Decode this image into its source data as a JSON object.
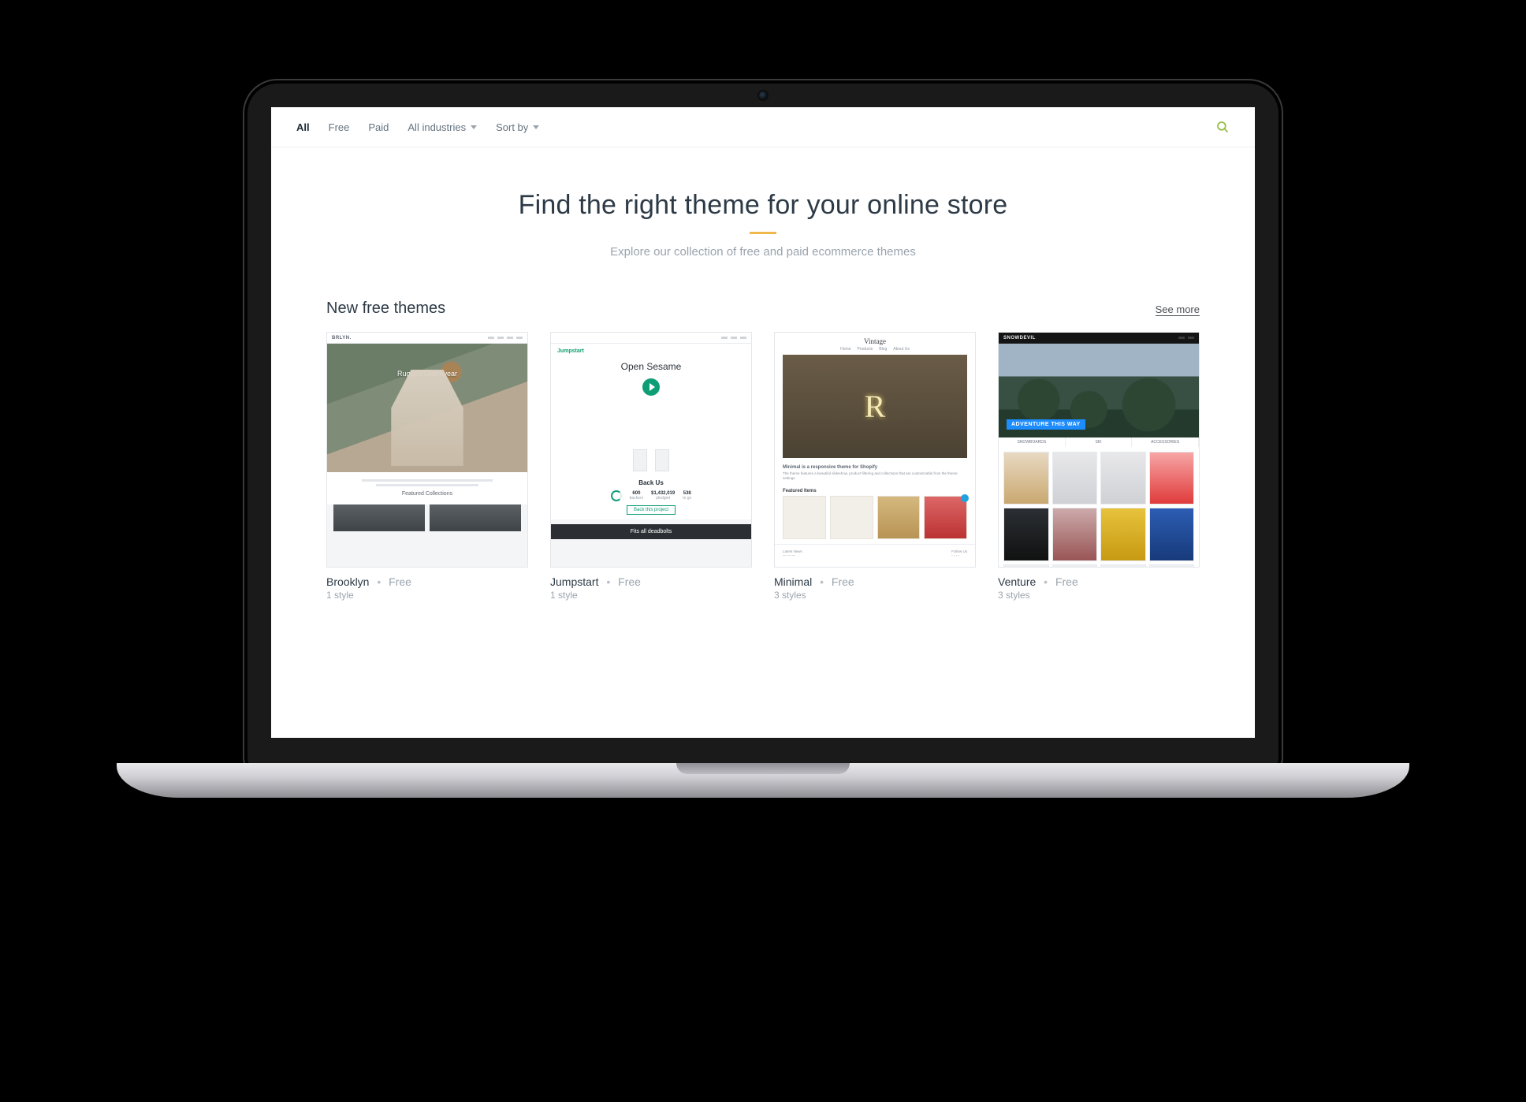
{
  "filters": {
    "all": "All",
    "free": "Free",
    "paid": "Paid",
    "industries": "All industries",
    "sort": "Sort by"
  },
  "hero": {
    "title": "Find the right theme for your online store",
    "subtitle": "Explore our collection of free and paid ecommerce themes"
  },
  "section": {
    "title": "New free themes",
    "see_more": "See more"
  },
  "themes": [
    {
      "name": "Brooklyn",
      "price": "Free",
      "styles": "1 style",
      "preview": {
        "brand": "BRLYN.",
        "hero_text": "Rugged Outerwear",
        "featured": "Featured Collections"
      }
    },
    {
      "name": "Jumpstart",
      "price": "Free",
      "styles": "1 style",
      "preview": {
        "logo": "Jumpstart",
        "headline": "Open Sesame",
        "back_us": "Back Us",
        "stat1": "600",
        "stat2": "$1,432,019",
        "stat3": "538",
        "cta": "Back this project",
        "band": "Fits all deadbolts"
      }
    },
    {
      "name": "Minimal",
      "price": "Free",
      "styles": "3 styles",
      "preview": {
        "brand": "Vintage",
        "tagline": "Minimal is a responsive theme for Shopify",
        "featured": "Featured Items"
      }
    },
    {
      "name": "Venture",
      "price": "Free",
      "styles": "3 styles",
      "preview": {
        "brand": "SNOWDEVIL",
        "tag": "ADVENTURE THIS WAY",
        "cat1": "SNOWBOARDS",
        "cat2": "SKI",
        "cat3": "ACCESSORIES"
      }
    }
  ]
}
